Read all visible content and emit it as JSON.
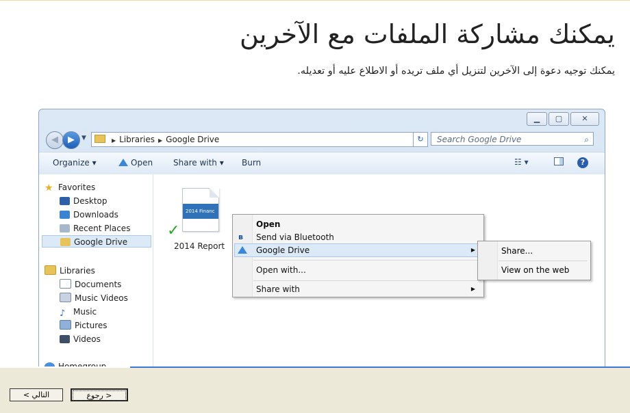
{
  "heading": {
    "title": "يمكنك مشاركة الملفات مع الآخرين",
    "subtitle": "يمكنك توجيه دعوة إلى الآخرين لتنزيل أي ملف تريده أو الاطلاع عليه أو تعديله."
  },
  "explorer": {
    "breadcrumb": [
      "Libraries",
      "Google Drive"
    ],
    "search_placeholder": "Search Google Drive",
    "toolbar": {
      "organize": "Organize",
      "open": "Open",
      "share_with": "Share with",
      "burn": "Burn"
    },
    "nav": {
      "favorites": "Favorites",
      "desktop": "Desktop",
      "downloads": "Downloads",
      "recent": "Recent Places",
      "google_drive": "Google Drive",
      "libraries": "Libraries",
      "documents": "Documents",
      "music_videos": "Music Videos",
      "music": "Music",
      "pictures": "Pictures",
      "videos": "Videos",
      "homegroup": "Homegroup"
    },
    "file": {
      "thumb_text": "2014 Financ",
      "name": "2014 Report"
    }
  },
  "context_menu": {
    "open": "Open",
    "bluetooth": "Send via Bluetooth",
    "google_drive": "Google Drive",
    "open_with": "Open with...",
    "share_with": "Share with"
  },
  "submenu": {
    "share": "Share...",
    "view_web": "View on the web"
  },
  "wizard": {
    "back": "< رجوع",
    "next": "التالي >"
  },
  "colors": {
    "accent": "#3b78d4",
    "band": "#ece9d8"
  }
}
